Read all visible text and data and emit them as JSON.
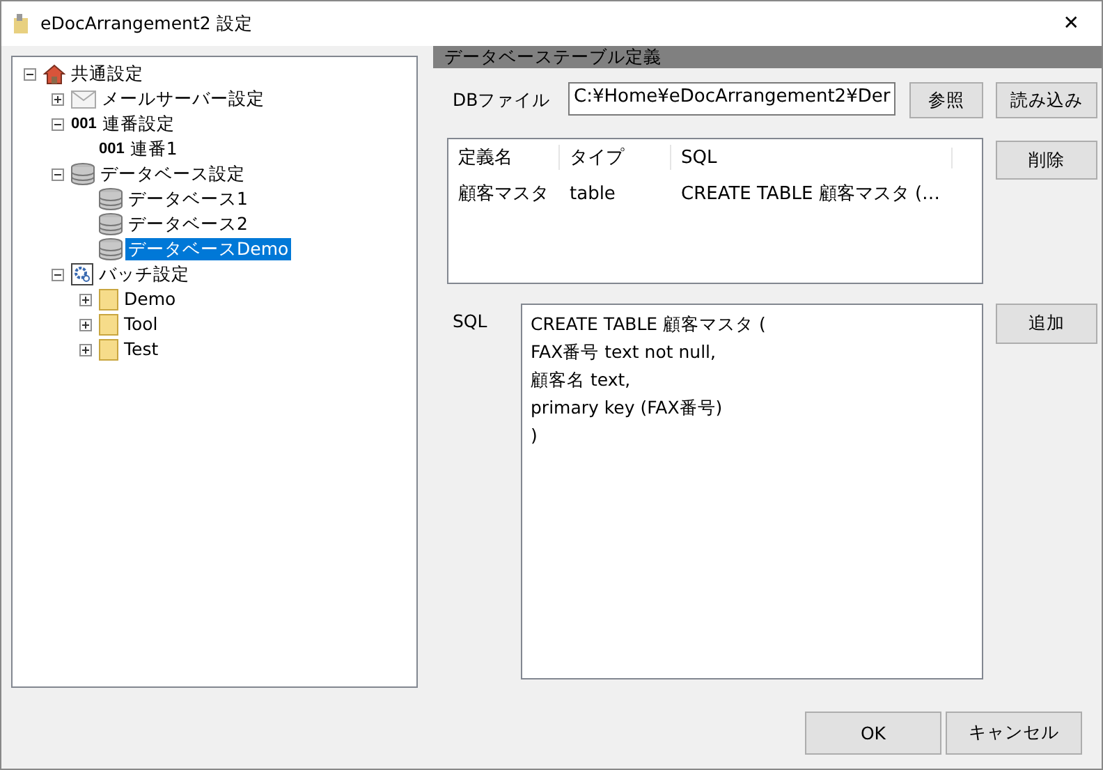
{
  "window": {
    "title": "eDocArrangement2 設定",
    "close": "✕"
  },
  "tree": [
    {
      "label": "共通設定",
      "kind": "house",
      "expanded": true,
      "selected": false,
      "children": [
        {
          "label": "メールサーバー設定",
          "kind": "mail",
          "expanded": false,
          "selected": false
        },
        {
          "label": "連番設定",
          "kind": "number",
          "badge": "001",
          "expanded": true,
          "selected": false,
          "children": [
            {
              "label": "連番1",
              "kind": "number",
              "badge": "001",
              "selected": false
            }
          ]
        },
        {
          "label": "データベース設定",
          "kind": "database",
          "expanded": true,
          "selected": false,
          "children": [
            {
              "label": "データベース1",
              "kind": "database",
              "selected": false
            },
            {
              "label": "データベース2",
              "kind": "database",
              "selected": false
            },
            {
              "label": "データベースDemo",
              "kind": "database",
              "selected": true
            }
          ]
        },
        {
          "label": "バッチ設定",
          "kind": "gear",
          "expanded": true,
          "selected": false,
          "children": [
            {
              "label": "Demo",
              "kind": "folder",
              "expanded": false,
              "selected": false
            },
            {
              "label": "Tool",
              "kind": "folder",
              "expanded": false,
              "selected": false
            },
            {
              "label": "Test",
              "kind": "folder",
              "expanded": false,
              "selected": false
            }
          ]
        }
      ]
    }
  ],
  "panel": {
    "title": "データベーステーブル定義",
    "db_file": {
      "label": "DBファイル",
      "value": "C:¥Home¥eDocArrangement2¥Der"
    },
    "browse_button": "参照",
    "load_button": "読み込み",
    "delete_button": "削除",
    "add_button": "追加",
    "table": {
      "columns": [
        "定義名",
        "タイプ",
        "SQL"
      ],
      "rows": [
        [
          "顧客マスタ",
          "table",
          "CREATE TABLE 顧客マスタ (…"
        ]
      ]
    },
    "sql": {
      "label": "SQL",
      "value": "CREATE TABLE 顧客マスタ (\nFAX番号 text not null,\n顧客名 text,\nprimary key (FAX番号)\n)"
    }
  },
  "buttons": [
    "OK",
    "キャンセル"
  ]
}
